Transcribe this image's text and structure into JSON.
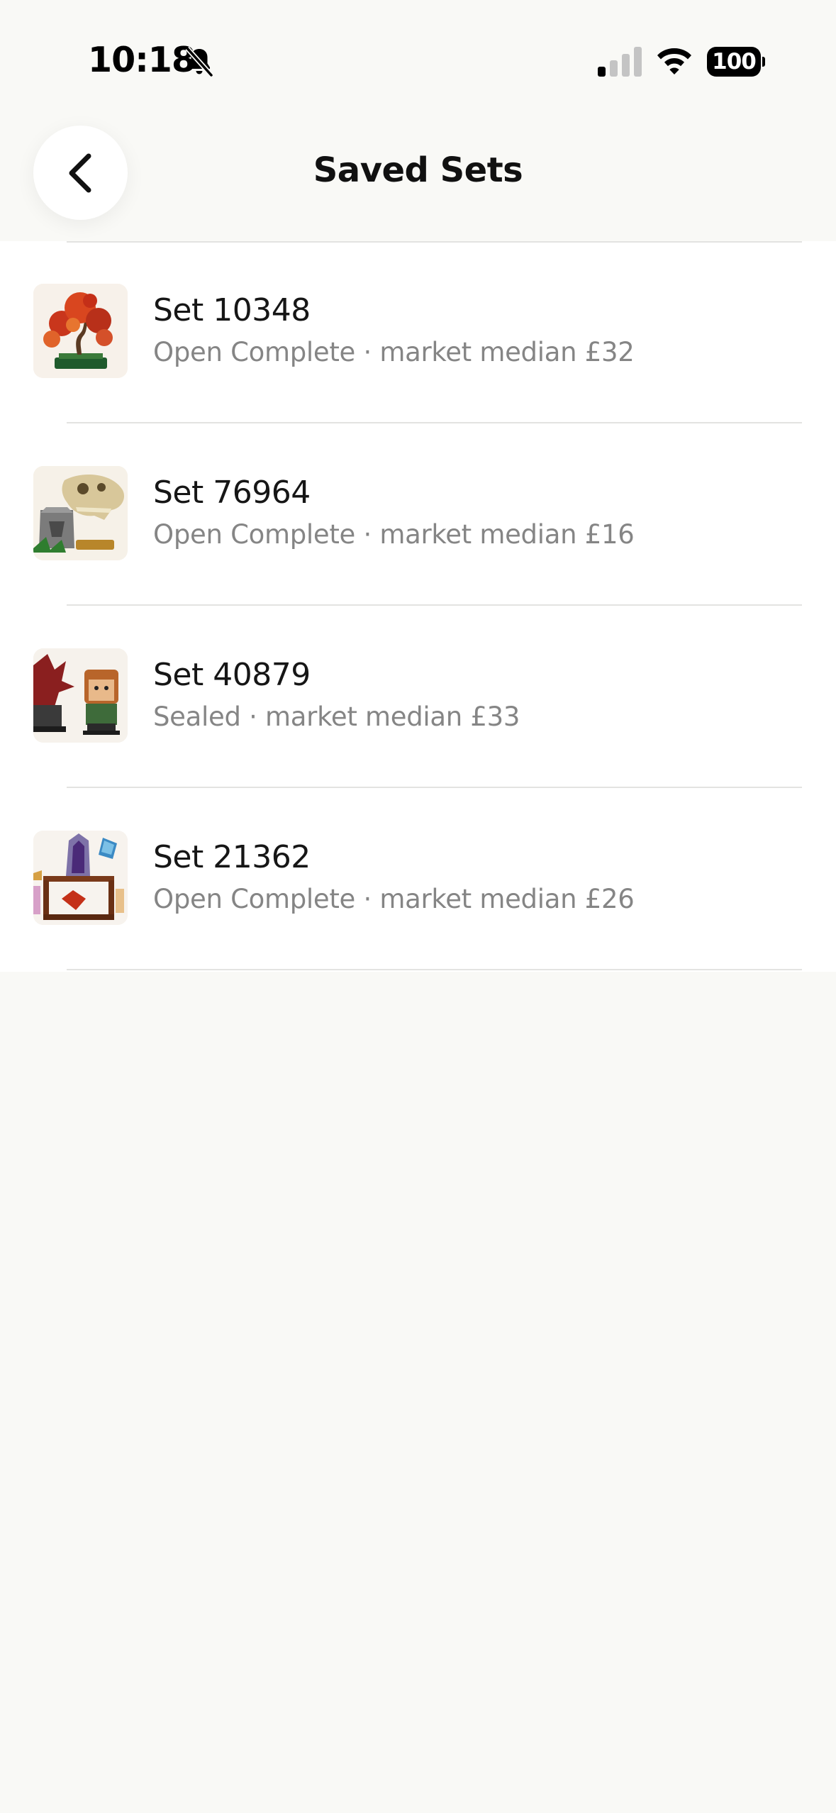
{
  "status_bar": {
    "time": "10:18",
    "battery": "100",
    "icons": [
      "bell-slash-icon",
      "cellular-signal-icon",
      "wifi-icon",
      "battery-icon"
    ]
  },
  "header": {
    "title": "Saved Sets",
    "back_icon": "chevron-left-icon"
  },
  "sets": [
    {
      "name": "Set 10348",
      "subtitle": "Open Complete · market median £32",
      "thumbnail": "bonsai-tree-image"
    },
    {
      "name": "Set 76964",
      "subtitle": "Open Complete · market median £16",
      "thumbnail": "dinosaur-skull-image"
    },
    {
      "name": "Set 40879",
      "subtitle": "Sealed · market median £33",
      "thumbnail": "brickheadz-figures-image"
    },
    {
      "name": "Set 21362",
      "subtitle": "Open Complete · market median £26",
      "thumbnail": "crystal-display-image"
    }
  ],
  "colors": {
    "background": "#f9f9f6",
    "list_background": "#ffffff",
    "primary_text": "#161616",
    "secondary_text": "#858585",
    "divider": "#e3e3e1"
  }
}
